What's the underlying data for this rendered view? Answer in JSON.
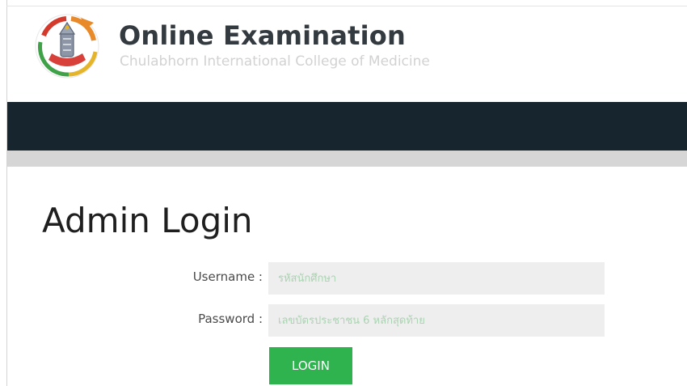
{
  "header": {
    "title": "Online Examination",
    "subtitle": "Chulabhorn International College of Medicine",
    "logo_icon": "college-seal-logo"
  },
  "colors": {
    "navbar": "#17252f",
    "accent_button": "#2eb34f",
    "input_background": "#eeeeee",
    "placeholder_text": "#a9d4b1"
  },
  "main": {
    "page_title": "Admin Login",
    "form": {
      "username_label": "Username :",
      "username_placeholder": "รหัสนักศึกษา",
      "password_label": "Password :",
      "password_placeholder": "เลขบัตรประชาชน 6 หลักสุดท้าย",
      "login_label": "LOGIN"
    }
  }
}
